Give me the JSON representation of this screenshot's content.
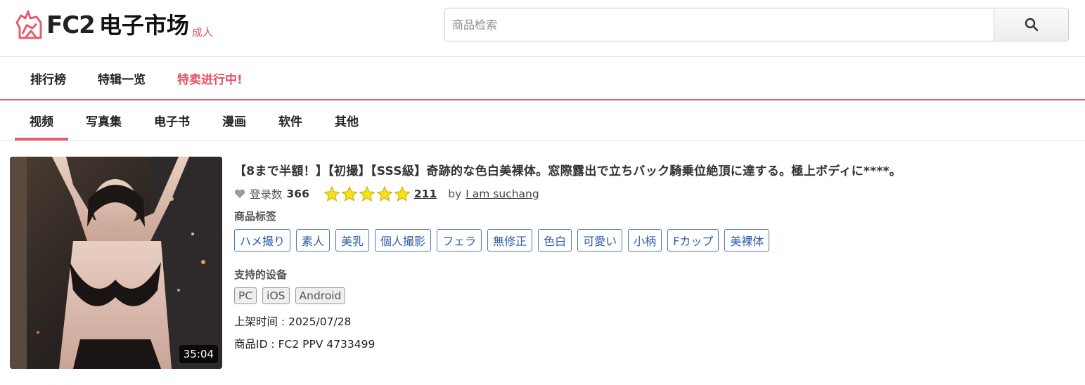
{
  "header": {
    "logo_fc2": "FC2",
    "logo_cn": "电子市场",
    "logo_adult": "成人",
    "search_placeholder": "商品检索"
  },
  "topnav": [
    "排行榜",
    "特辑一览",
    "特卖进行中!"
  ],
  "categories": [
    "视频",
    "写真集",
    "电子书",
    "漫画",
    "软件",
    "其他"
  ],
  "active_category": "视频",
  "product": {
    "duration": "35:04",
    "title": "【8まで半額！】【初撮】【SSS級】奇跡的な色白美裸体。窓際露出で立ちバック騎乗位絶頂に達する。極上ボディに****。",
    "favorites_label": "登录数",
    "favorites_count": "366",
    "rating": 5,
    "review_count": "211",
    "by_label": "by",
    "author": "I am suchang",
    "tags_label": "商品标签",
    "tags": [
      "ハメ撮り",
      "素人",
      "美乳",
      "個人撮影",
      "フェラ",
      "無修正",
      "色白",
      "可愛い",
      "小柄",
      "Fカップ",
      "美裸体"
    ],
    "devices_label": "支持的设备",
    "devices": [
      "PC",
      "iOS",
      "Android"
    ],
    "release": "上架时间 : 2025/07/28",
    "product_id": "商品ID : FC2 PPV 4733499"
  },
  "colors": {
    "accent": "#e05e6e",
    "tag_border": "#4a77bb",
    "star": "#f5e21b"
  }
}
